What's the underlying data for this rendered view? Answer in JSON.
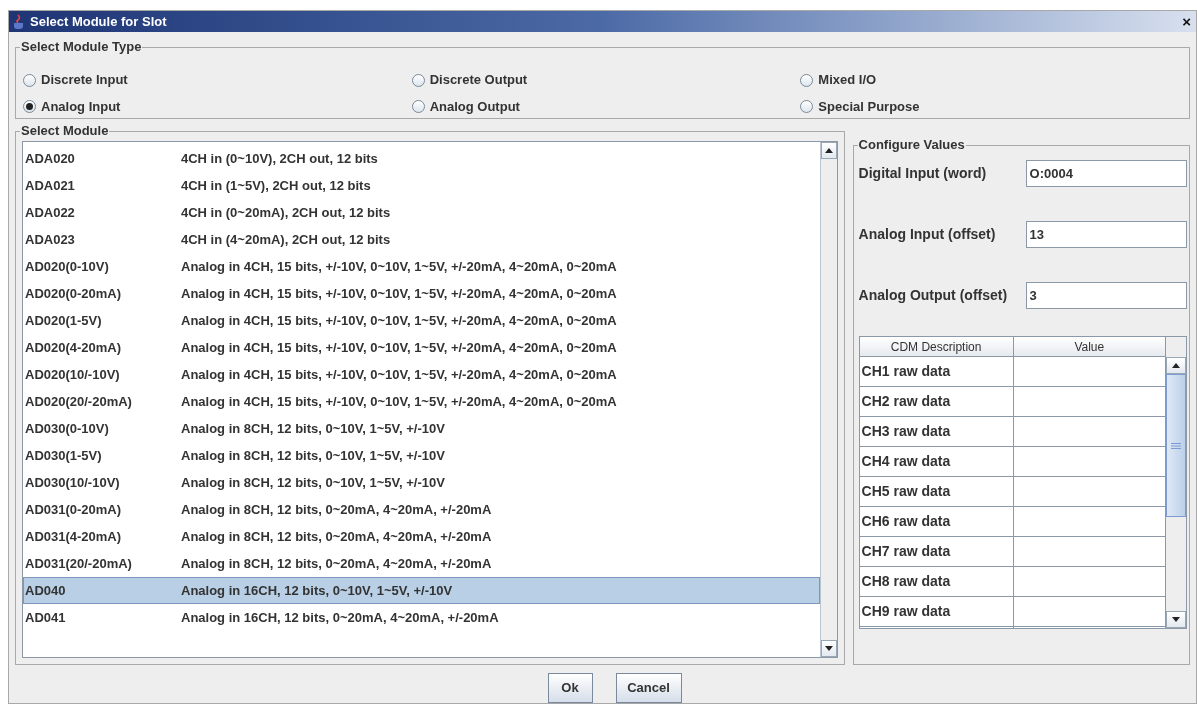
{
  "window": {
    "title": "Select Module for Slot",
    "close": "×"
  },
  "module_type": {
    "title": "Select Module Type",
    "options": [
      {
        "label": "Discrete Input",
        "selected": false
      },
      {
        "label": "Discrete Output",
        "selected": false
      },
      {
        "label": "Mixed I/O",
        "selected": false
      },
      {
        "label": "Analog Input",
        "selected": true
      },
      {
        "label": "Analog Output",
        "selected": false
      },
      {
        "label": "Special Purpose",
        "selected": false
      }
    ]
  },
  "module_list": {
    "title": "Select Module",
    "rows": [
      {
        "name": "ADA020",
        "description": "4CH in (0~10V), 2CH out, 12 bits",
        "selected": false
      },
      {
        "name": "ADA021",
        "description": "4CH in (1~5V), 2CH out, 12 bits",
        "selected": false
      },
      {
        "name": "ADA022",
        "description": "4CH in (0~20mA), 2CH out, 12 bits",
        "selected": false
      },
      {
        "name": "ADA023",
        "description": "4CH in (4~20mA), 2CH out, 12 bits",
        "selected": false
      },
      {
        "name": "AD020(0-10V)",
        "description": "Analog in 4CH, 15 bits, +/-10V, 0~10V, 1~5V, +/-20mA, 4~20mA, 0~20mA",
        "selected": false
      },
      {
        "name": "AD020(0-20mA)",
        "description": "Analog in 4CH, 15 bits, +/-10V, 0~10V, 1~5V, +/-20mA, 4~20mA, 0~20mA",
        "selected": false
      },
      {
        "name": "AD020(1-5V)",
        "description": "Analog in 4CH, 15 bits, +/-10V, 0~10V, 1~5V, +/-20mA, 4~20mA, 0~20mA",
        "selected": false
      },
      {
        "name": "AD020(4-20mA)",
        "description": "Analog in 4CH, 15 bits, +/-10V, 0~10V, 1~5V, +/-20mA, 4~20mA, 0~20mA",
        "selected": false
      },
      {
        "name": "AD020(10/-10V)",
        "description": "Analog in 4CH, 15 bits, +/-10V, 0~10V, 1~5V, +/-20mA, 4~20mA, 0~20mA",
        "selected": false
      },
      {
        "name": "AD020(20/-20mA)",
        "description": "Analog in 4CH, 15 bits, +/-10V, 0~10V, 1~5V, +/-20mA, 4~20mA, 0~20mA",
        "selected": false
      },
      {
        "name": "AD030(0-10V)",
        "description": "Analog in 8CH, 12 bits, 0~10V, 1~5V, +/-10V",
        "selected": false
      },
      {
        "name": "AD030(1-5V)",
        "description": "Analog in 8CH, 12 bits, 0~10V, 1~5V, +/-10V",
        "selected": false
      },
      {
        "name": "AD030(10/-10V)",
        "description": "Analog in 8CH, 12 bits, 0~10V, 1~5V, +/-10V",
        "selected": false
      },
      {
        "name": "AD031(0-20mA)",
        "description": "Analog in 8CH, 12 bits, 0~20mA, 4~20mA, +/-20mA",
        "selected": false
      },
      {
        "name": "AD031(4-20mA)",
        "description": "Analog in 8CH, 12 bits, 0~20mA, 4~20mA, +/-20mA",
        "selected": false
      },
      {
        "name": "AD031(20/-20mA)",
        "description": "Analog in 8CH, 12 bits, 0~20mA, 4~20mA, +/-20mA",
        "selected": false
      },
      {
        "name": "AD040",
        "description": "Analog in 16CH, 12 bits, 0~10V, 1~5V, +/-10V",
        "selected": true
      },
      {
        "name": "AD041",
        "description": "Analog in 16CH, 12 bits, 0~20mA, 4~20mA, +/-20mA",
        "selected": false
      }
    ]
  },
  "configure": {
    "title": "Configure Values",
    "fields": [
      {
        "label": "Digital Input (word)",
        "value": "O:0004"
      },
      {
        "label": "Analog Input (offset)",
        "value": "13"
      },
      {
        "label": "Analog Output (offset)",
        "value": "3"
      }
    ],
    "table": {
      "columns": [
        "CDM Description",
        "Value"
      ],
      "rows": [
        {
          "description": "CH1 raw data"
        },
        {
          "description": "CH2 raw data"
        },
        {
          "description": "CH3 raw data"
        },
        {
          "description": "CH4 raw data"
        },
        {
          "description": "CH5 raw data"
        },
        {
          "description": "CH6 raw data"
        },
        {
          "description": "CH7 raw data"
        },
        {
          "description": "CH8 raw data"
        },
        {
          "description": "CH9 raw data"
        }
      ]
    }
  },
  "buttons": [
    "Ok",
    "Cancel"
  ]
}
